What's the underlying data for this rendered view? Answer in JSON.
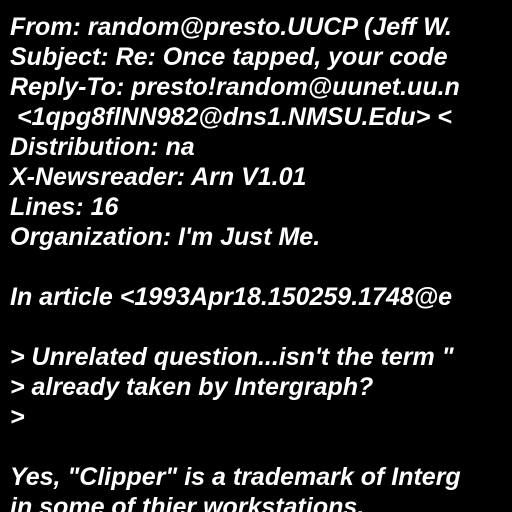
{
  "colors": {
    "background": "#000000",
    "text": "#ffffff"
  },
  "header": {
    "from": "From: random@presto.UUCP (Jeff W.",
    "subject": "Subject: Re: Once tapped, your code",
    "reply_to": "Reply-To: presto!random@uunet.uu.n",
    "references": " <1qpg8flNN982@dns1.NMSU.Edu> <",
    "distribution": "Distribution: na",
    "newsreader": "X-Newsreader: Arn V1.01",
    "lines": "Lines: 16",
    "organization": "Organization: I'm Just Me."
  },
  "body": {
    "attribution": "In article <1993Apr18.150259.1748@e",
    "quote_1": "> Unrelated question...isn't the term \"",
    "quote_2": "> already taken by Intergraph?",
    "quote_3": ">",
    "reply_1": "Yes, \"Clipper\" is a trademark of Interg",
    "reply_2": "in some of thier workstations."
  }
}
